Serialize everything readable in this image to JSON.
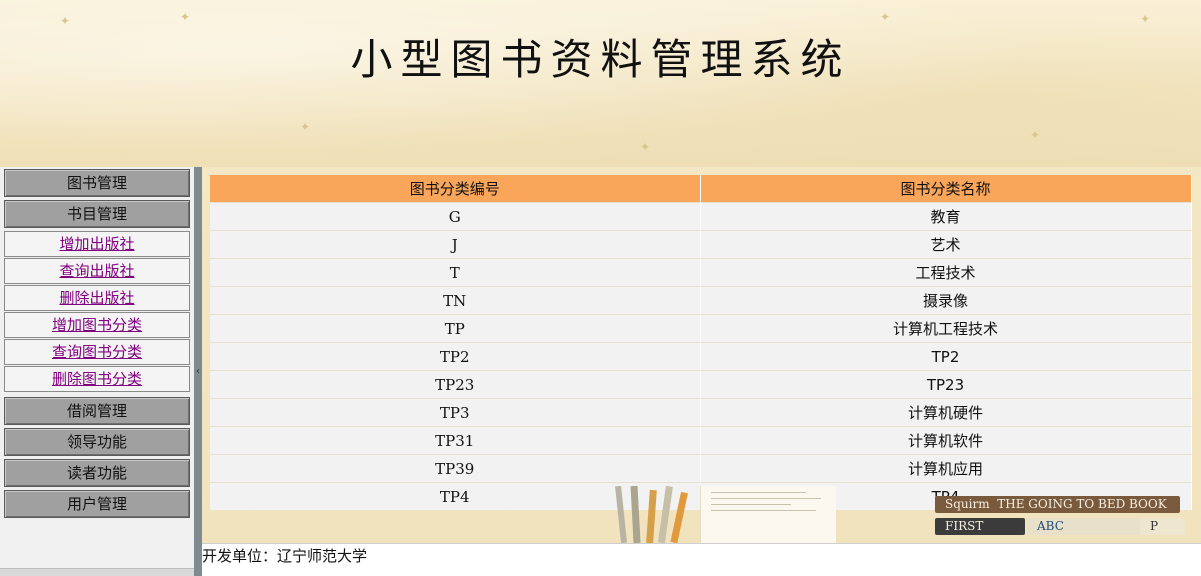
{
  "header": {
    "title": "小型图书资料管理系统"
  },
  "sidebar": {
    "items": [
      {
        "label": "图书管理",
        "type": "header"
      },
      {
        "label": "书目管理",
        "type": "header"
      },
      {
        "label": "增加出版社",
        "type": "link"
      },
      {
        "label": "查询出版社",
        "type": "link"
      },
      {
        "label": "删除出版社",
        "type": "link"
      },
      {
        "label": "增加图书分类",
        "type": "link"
      },
      {
        "label": "查询图书分类",
        "type": "link"
      },
      {
        "label": "删除图书分类",
        "type": "link"
      },
      {
        "label": "借阅管理",
        "type": "header"
      },
      {
        "label": "领导功能",
        "type": "header"
      },
      {
        "label": "读者功能",
        "type": "header"
      },
      {
        "label": "用户管理",
        "type": "header"
      }
    ]
  },
  "table": {
    "columns": [
      "图书分类编号",
      "图书分类名称"
    ],
    "rows": [
      [
        "G",
        "教育"
      ],
      [
        "J",
        "艺术"
      ],
      [
        "T",
        "工程技术"
      ],
      [
        "TN",
        "摄录像"
      ],
      [
        "TP",
        "计算机工程技术"
      ],
      [
        "TP2",
        "TP2"
      ],
      [
        "TP23",
        "TP23"
      ],
      [
        "TP3",
        "计算机硬件"
      ],
      [
        "TP31",
        "计算机软件"
      ],
      [
        "TP39",
        "计算机应用"
      ],
      [
        "TP4",
        "TP4"
      ]
    ]
  },
  "decor": {
    "book_titles": [
      "Squirm",
      "THE GOING TO BED BOOK",
      "FIRST",
      "ABC",
      "P"
    ]
  },
  "footer": {
    "text": "开发单位：辽宁师范大学"
  },
  "colors": {
    "table_header": "#f9a65a",
    "sidebar_header": "#a0a0a0",
    "visited_link": "#800080",
    "splitter": "#7e8b91"
  }
}
